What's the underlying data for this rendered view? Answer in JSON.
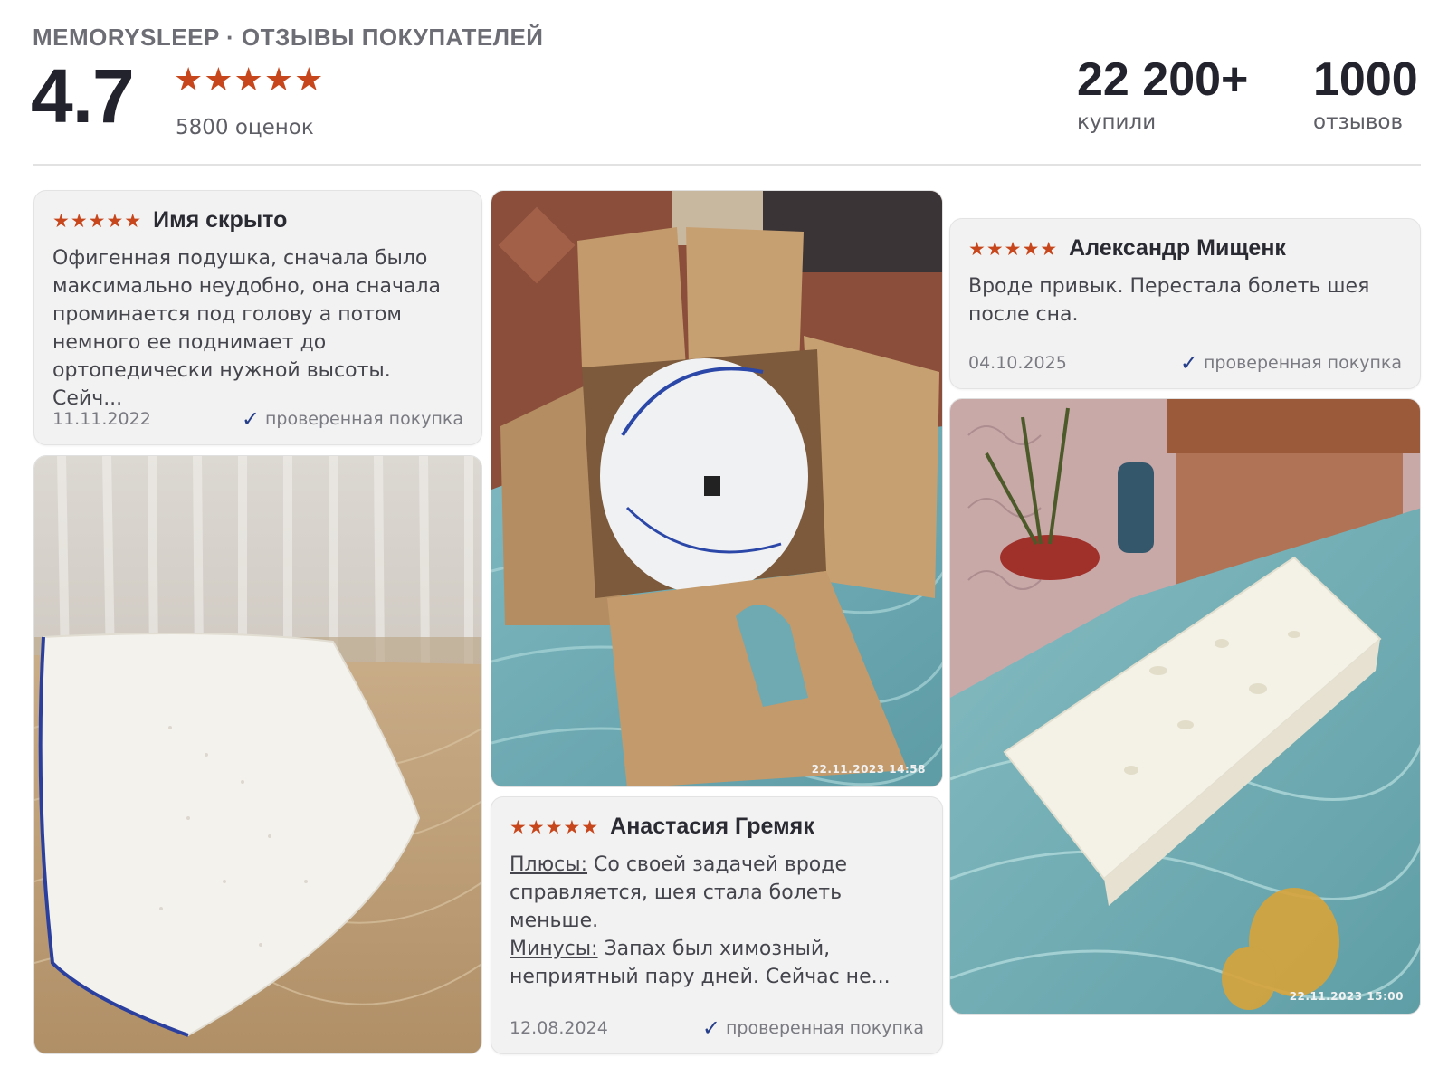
{
  "header": {
    "brand": "MEMORYSLEEP · ОТЗЫВЫ ПОКУПАТЕЛЕЙ",
    "rating": "4.7",
    "rating_stars": "★★★★★",
    "ratings_count": "5800 оценок",
    "stats": {
      "buyers_number": "22 200+",
      "buyers_label": "купили",
      "reviews_number": "1000",
      "reviews_label": "отзывов"
    }
  },
  "reviews": [
    {
      "stars": "★★★★★",
      "author": "Имя скрыто",
      "text": "Офигенная подушка, сначала было максимально неудобно, она сначала проминается под голову а потом немного ее поднимает до ортопедически нужной высоты. Сейч...",
      "date": "11.11.2022",
      "verified": "проверенная покупка"
    },
    {
      "stars": "★★★★★",
      "author": "Анастасия Гремяк",
      "pros_label": "Плюсы:",
      "pros_text": "Со своей задачей вроде справляется, шея стала болеть меньше.",
      "cons_label": "Минусы:",
      "cons_text": "Запах был химозный, неприятный пару дней. Сейчас не...",
      "date": "12.08.2024",
      "verified": "проверенная покупка"
    },
    {
      "stars": "★★★★★",
      "author": "Александр Мищенк",
      "text": "Вроде привык. Перестала болеть шея после сна.",
      "date": "04.10.2025",
      "verified": "проверенная покупка"
    }
  ],
  "photos": {
    "box_timestamp": "22.11.2023  14:58",
    "pillow_bed_timestamp": "22.11.2023  15:00"
  },
  "colors": {
    "star": "#c8461b",
    "check": "#263f8a",
    "card_bg": "#f3f2f2"
  }
}
